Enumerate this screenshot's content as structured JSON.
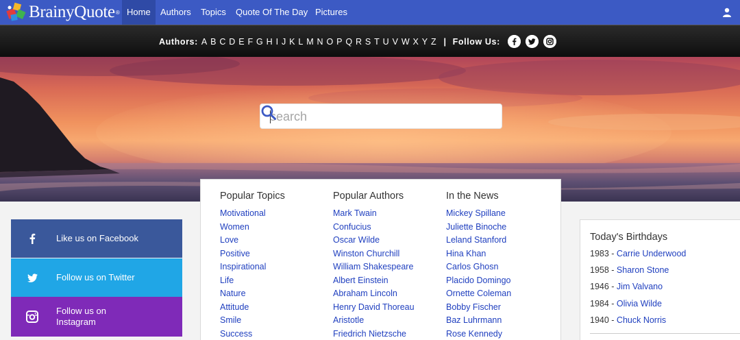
{
  "brand": {
    "name": "BrainyQuote",
    "reg": "®"
  },
  "nav": {
    "items": [
      {
        "label": "Home",
        "active": true
      },
      {
        "label": "Authors"
      },
      {
        "label": "Topics"
      },
      {
        "label": "Quote Of The Day"
      },
      {
        "label": "Pictures"
      }
    ],
    "user_icon": "user-icon"
  },
  "alphabar": {
    "authors_label": "Authors:",
    "letters": [
      "A",
      "B",
      "C",
      "D",
      "E",
      "F",
      "G",
      "H",
      "I",
      "J",
      "K",
      "L",
      "M",
      "N",
      "O",
      "P",
      "Q",
      "R",
      "S",
      "T",
      "U",
      "V",
      "W",
      "X",
      "Y",
      "Z"
    ],
    "separator": "|",
    "follow_label": "Follow Us:",
    "social_icons": [
      "facebook-icon",
      "twitter-icon",
      "instagram-icon"
    ]
  },
  "search": {
    "placeholder": "search",
    "icon": "search-icon"
  },
  "popular": {
    "topics": {
      "title": "Popular Topics",
      "items": [
        "Motivational",
        "Women",
        "Love",
        "Positive",
        "Inspirational",
        "Life",
        "Nature",
        "Attitude",
        "Smile",
        "Success"
      ]
    },
    "authors": {
      "title": "Popular Authors",
      "items": [
        "Mark Twain",
        "Confucius",
        "Oscar Wilde",
        "Winston Churchill",
        "William Shakespeare",
        "Albert Einstein",
        "Abraham Lincoln",
        "Henry David Thoreau",
        "Aristotle",
        "Friedrich Nietzsche"
      ]
    },
    "news": {
      "title": "In the News",
      "items": [
        "Mickey Spillane",
        "Juliette Binoche",
        "Leland Stanford",
        "Hina Khan",
        "Carlos Ghosn",
        "Placido Domingo",
        "Ornette Coleman",
        "Bobby Fischer",
        "Baz Luhrmann",
        "Rose Kennedy"
      ]
    }
  },
  "social_buttons": {
    "facebook": {
      "label": "Like us on Facebook",
      "color": "#3a589b"
    },
    "twitter": {
      "label": "Follow us on Twitter",
      "color": "#20a6e6"
    },
    "instagram": {
      "label_line1": "Follow us on",
      "label_line2": "Instagram",
      "color": "#7f2ab8"
    }
  },
  "birthdays": {
    "title": "Today's Birthdays",
    "items": [
      {
        "year": "1983",
        "name": "Carrie Underwood"
      },
      {
        "year": "1958",
        "name": "Sharon Stone"
      },
      {
        "year": "1946",
        "name": "Jim Valvano"
      },
      {
        "year": "1984",
        "name": "Olivia Wilde"
      },
      {
        "year": "1940",
        "name": "Chuck Norris"
      }
    ]
  },
  "colors": {
    "nav_bg": "#3c5ac4",
    "link": "#1f3fbf",
    "search_icon": "#3c5ac4"
  }
}
